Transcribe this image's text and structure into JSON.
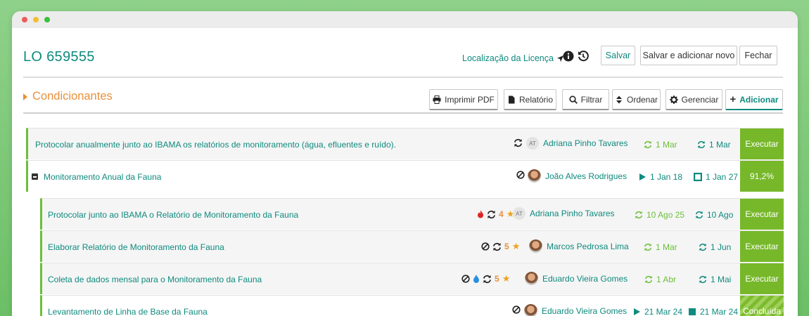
{
  "header": {
    "title": "LO 659555",
    "location_link": "Localização da Licença",
    "buttons": {
      "save": "Salvar",
      "save_new": "Salvar e adicionar novo",
      "close": "Fechar"
    }
  },
  "section": {
    "title": "Condicionantes",
    "toolbar": {
      "print_pdf": "Imprimir PDF",
      "report": "Relatório",
      "filter": "Filtrar",
      "order": "Ordenar",
      "manage": "Gerenciar",
      "add": "Adicionar"
    }
  },
  "rows": [
    {
      "title": "Protocolar anualmente junto ao IBAMA os relatórios de monitoramento (água, efluentes e ruído).",
      "person": "Adriana Pinho Tavares",
      "avatar_initials": "AT",
      "date1": "1 Mar",
      "date2": "1 Mar",
      "action": "Executar"
    },
    {
      "title": "Monitoramento Anual da Fauna",
      "person": "João Alves Rodrigues",
      "date1": "1 Jan 18",
      "date2": "1 Jan 27",
      "action": "91,2%"
    },
    {
      "title": "Protocolar junto ao IBAMA o Relatório de Monitoramento da Fauna",
      "person": "Adriana Pinho Tavares",
      "avatar_initials": "AT",
      "count": "4",
      "date1": "10 Ago 25",
      "date2": "10 Ago",
      "action": "Executar"
    },
    {
      "title": "Elaborar Relatório de Monitoramento da Fauna",
      "person": "Marcos Pedrosa Lima",
      "count": "5",
      "date1": "1 Mar",
      "date2": "1 Jun",
      "action": "Executar"
    },
    {
      "title": "Coleta de dados mensal para o Monitoramento da Fauna",
      "person": "Eduardo Vieira Gomes",
      "count": "5",
      "date1": "1 Abr",
      "date2": "1 Mai",
      "action": "Executar"
    },
    {
      "title": "Levantamento de Linha de Base da Fauna",
      "person": "Eduardo Vieira Gomes",
      "date1": "21 Mar 24",
      "date2": "21 Mar 24",
      "action": "Concluída"
    }
  ],
  "colors": {
    "teal": "#0e8a7e",
    "green": "#77b82a",
    "orange": "#e8903a"
  }
}
